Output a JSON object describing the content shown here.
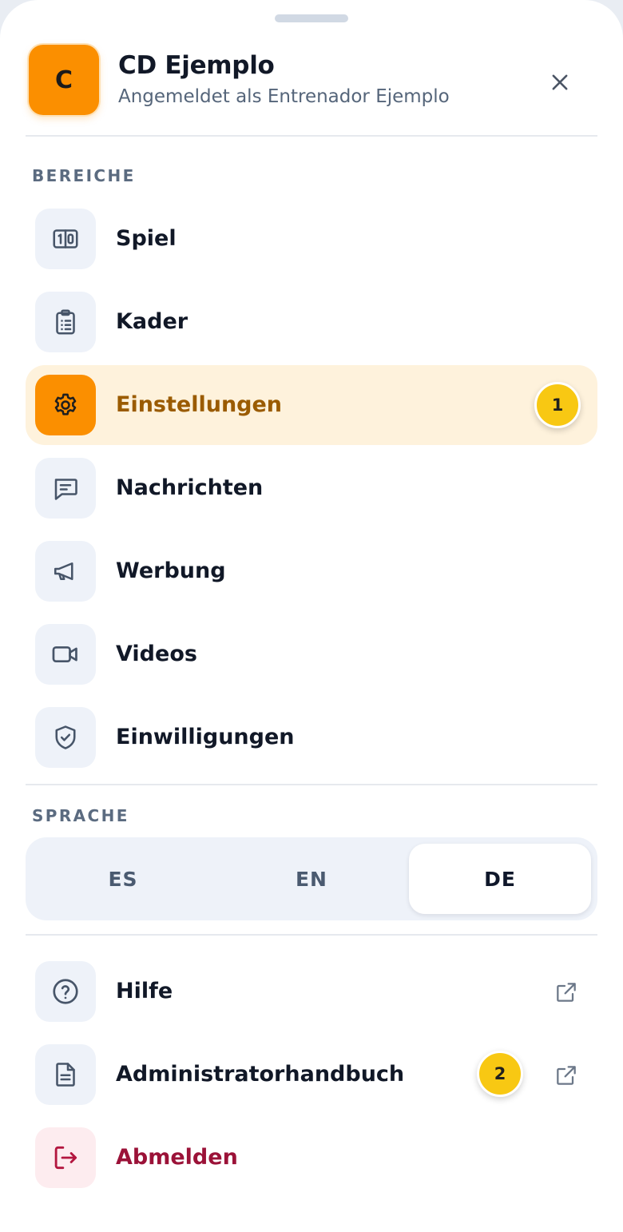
{
  "header": {
    "avatar_initial": "C",
    "club_name": "CD Ejemplo",
    "logged_in_as": "Angemeldet als Entrenador Ejemplo",
    "close_icon": "close-icon"
  },
  "sections": {
    "areas_label": "BEREICHE",
    "language_label": "SPRACHE"
  },
  "menu": {
    "items": [
      {
        "label": "Spiel",
        "icon": "scoreboard-icon"
      },
      {
        "label": "Kader",
        "icon": "clipboard-list-icon"
      },
      {
        "label": "Einstellungen",
        "icon": "gear-icon",
        "active": true,
        "badge": "1"
      },
      {
        "label": "Nachrichten",
        "icon": "message-icon"
      },
      {
        "label": "Werbung",
        "icon": "megaphone-icon"
      },
      {
        "label": "Videos",
        "icon": "video-camera-icon"
      },
      {
        "label": "Einwilligungen",
        "icon": "shield-check-icon"
      }
    ]
  },
  "language": {
    "options": [
      "ES",
      "EN",
      "DE"
    ],
    "selected": "DE"
  },
  "footer": {
    "items": [
      {
        "label": "Hilfe",
        "icon": "help-circle-icon",
        "external": true
      },
      {
        "label": "Administratorhandbuch",
        "icon": "document-icon",
        "external": true,
        "badge": "2"
      },
      {
        "label": "Abmelden",
        "icon": "logout-icon",
        "danger": true
      }
    ]
  },
  "colors": {
    "accent": "#fb8f00",
    "active_bg": "#fef2dc",
    "active_text": "#9a5b00",
    "badge": "#f8c813",
    "danger": "#9b1238",
    "icon_tile": "#eef2f9"
  }
}
